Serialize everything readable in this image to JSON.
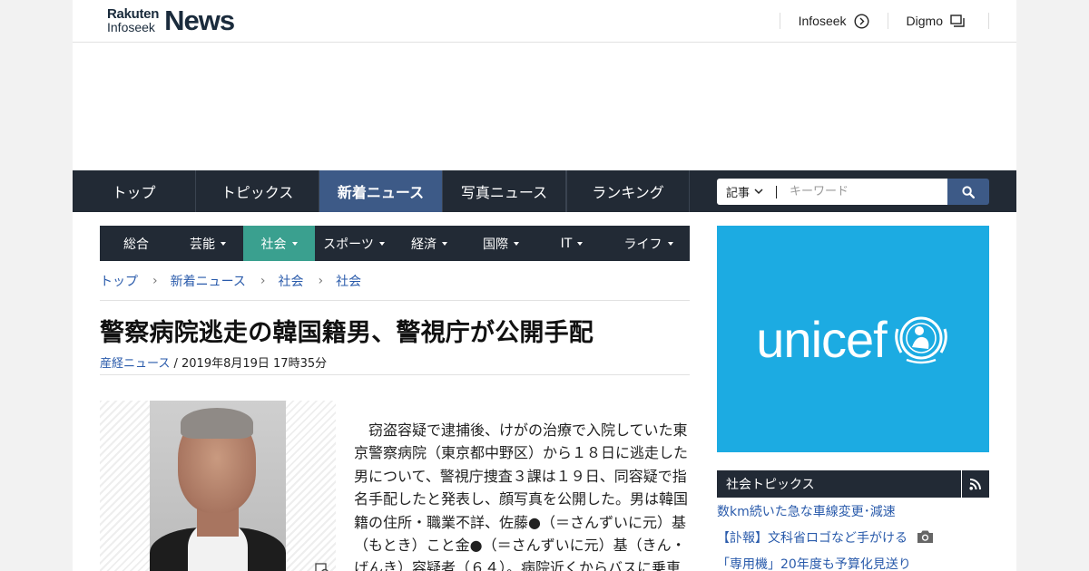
{
  "header": {
    "logo_rakuten": "Rakuten",
    "logo_infoseek": "Infoseek",
    "logo_news": "News",
    "links": [
      {
        "label": "Infoseek",
        "icon": "circle-arrow-right-icon"
      },
      {
        "label": "Digmo",
        "icon": "window-stack-icon"
      }
    ]
  },
  "global_nav": {
    "items": [
      "トップ",
      "トピックス",
      "新着ニュース",
      "写真ニュース",
      "ランキング"
    ],
    "active": "新着ニュース"
  },
  "search": {
    "category": "記事",
    "placeholder": "キーワード",
    "icon": "search-icon"
  },
  "sub_nav": {
    "items": [
      {
        "label": "総合",
        "dropdown": false
      },
      {
        "label": "芸能",
        "dropdown": true
      },
      {
        "label": "社会",
        "dropdown": true
      },
      {
        "label": "スポーツ",
        "dropdown": true
      },
      {
        "label": "経済",
        "dropdown": true
      },
      {
        "label": "国際",
        "dropdown": true
      },
      {
        "label": "IT",
        "dropdown": true
      },
      {
        "label": "ライフ",
        "dropdown": true
      }
    ],
    "active": "社会"
  },
  "breadcrumb": [
    "トップ",
    "新着ニュース",
    "社会",
    "社会"
  ],
  "article": {
    "title": "警察病院逃走の韓国籍男、警視庁が公開手配",
    "source": "産経ニュース",
    "date": " / 2019年8月19日 17時35分",
    "body": "窃盗容疑で逮捕後、けがの治療で入院していた東京警察病院（東京都中野区）から１８日に逃走した男について、警視庁捜査３課は１９日、同容疑で指名手配したと発表し、顔写真を公開した。男は韓国籍の住所・職業不詳、佐藤●（＝さんずいに元）基（もとき）こと金●（＝さんずいに元）基（きん・げんき）容疑者（６４）。病院近くからバスに乗車"
  },
  "ad": {
    "text": "unicef",
    "color": "#1cabe2"
  },
  "topics": {
    "title": "社会トピックス",
    "items": [
      {
        "label": "数km続いた急な車線変更･減速",
        "camera": false
      },
      {
        "label": "【訃報】文科省ロゴなど手がける",
        "camera": true
      },
      {
        "label": "「専用機」20年度も予算化見送り",
        "camera": false
      }
    ]
  },
  "colors": {
    "nav_bg": "#222a35",
    "nav_active": "#3d5a87",
    "sub_active": "#3aa08f",
    "link": "#2a5bab"
  }
}
